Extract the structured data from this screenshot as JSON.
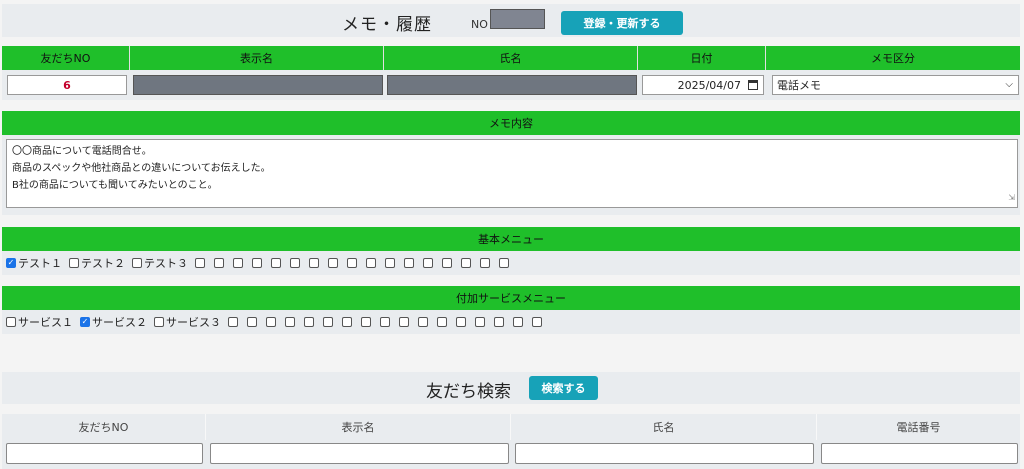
{
  "header": {
    "title": "メモ・履歴",
    "no_label": "NO",
    "register_button": "登録・更新する"
  },
  "columns": [
    "友だちNO",
    "表示名",
    "氏名",
    "日付",
    "メモ区分"
  ],
  "record": {
    "friend_no": "6",
    "date": "2025/04/07",
    "memo_type": "電話メモ"
  },
  "memo": {
    "label": "メモ内容",
    "lines": [
      "〇〇商品について電話問合せ。",
      "商品のスペックや他社商品との違いについてお伝えした。",
      "B社の商品についても聞いてみたいとのこと。"
    ]
  },
  "basic_menu": {
    "label": "基本メニュー",
    "items": [
      {
        "label": "テスト１",
        "checked": true
      },
      {
        "label": "テスト２",
        "checked": false
      },
      {
        "label": "テスト３",
        "checked": false
      }
    ],
    "empty_boxes": 17
  },
  "service_menu": {
    "label": "付加サービスメニュー",
    "items": [
      {
        "label": "サービス１",
        "checked": false
      },
      {
        "label": "サービス２",
        "checked": true
      },
      {
        "label": "サービス３",
        "checked": false
      }
    ],
    "empty_boxes": 17
  },
  "search": {
    "title": "友だち検索",
    "button": "検索する",
    "columns": [
      "友だちNO",
      "表示名",
      "氏名",
      "電話番号"
    ]
  },
  "colors": {
    "green": "#1fbf2a",
    "button": "#17a2b8"
  }
}
